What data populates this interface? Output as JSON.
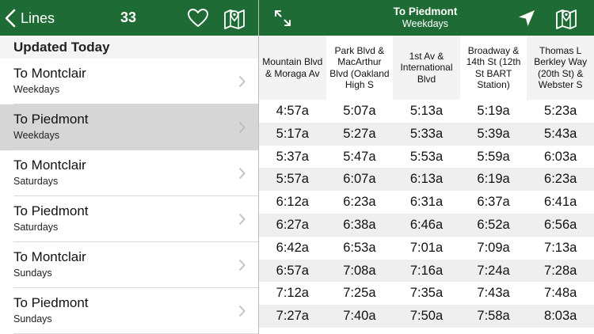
{
  "left": {
    "back_label": "Lines",
    "route_number": "33",
    "section_title": "Updated Today",
    "items": [
      {
        "title": "To Montclair",
        "subtitle": "Weekdays",
        "selected": false
      },
      {
        "title": "To Piedmont",
        "subtitle": "Weekdays",
        "selected": true
      },
      {
        "title": "To Montclair",
        "subtitle": "Saturdays",
        "selected": false
      },
      {
        "title": "To Piedmont",
        "subtitle": "Saturdays",
        "selected": false
      },
      {
        "title": "To Montclair",
        "subtitle": "Sundays",
        "selected": false
      },
      {
        "title": "To Piedmont",
        "subtitle": "Sundays",
        "selected": false
      }
    ]
  },
  "right": {
    "title": "To Piedmont",
    "subtitle": "Weekdays",
    "stops": [
      "Mountain Blvd & Moraga Av",
      "Park Blvd & MacArthur Blvd (Oakland High S",
      "1st Av & International Blvd",
      "Broadway & 14th St (12th St BART Station)",
      "Thomas L Berkley Way (20th St) & Webster S"
    ],
    "times": [
      [
        "4:57a",
        "5:07a",
        "5:13a",
        "5:19a",
        "5:23a"
      ],
      [
        "5:17a",
        "5:27a",
        "5:33a",
        "5:39a",
        "5:43a"
      ],
      [
        "5:37a",
        "5:47a",
        "5:53a",
        "5:59a",
        "6:03a"
      ],
      [
        "5:57a",
        "6:07a",
        "6:13a",
        "6:19a",
        "6:23a"
      ],
      [
        "6:12a",
        "6:23a",
        "6:31a",
        "6:37a",
        "6:41a"
      ],
      [
        "6:27a",
        "6:38a",
        "6:46a",
        "6:52a",
        "6:56a"
      ],
      [
        "6:42a",
        "6:53a",
        "7:01a",
        "7:09a",
        "7:13a"
      ],
      [
        "6:57a",
        "7:08a",
        "7:16a",
        "7:24a",
        "7:28a"
      ],
      [
        "7:12a",
        "7:25a",
        "7:35a",
        "7:43a",
        "7:48a"
      ],
      [
        "7:27a",
        "7:40a",
        "7:50a",
        "7:58a",
        "8:03a"
      ]
    ]
  },
  "colors": {
    "brand_green": "#1f6b35",
    "selected_row": "#d6d6d6",
    "alt_row": "#efefef"
  },
  "icons": {
    "back": "chevron-left-icon",
    "favorite": "heart-outline-icon",
    "map": "map-pin-icon",
    "expand": "expand-arrows-icon",
    "locate": "location-arrow-icon",
    "disclosure": "chevron-right-icon"
  }
}
